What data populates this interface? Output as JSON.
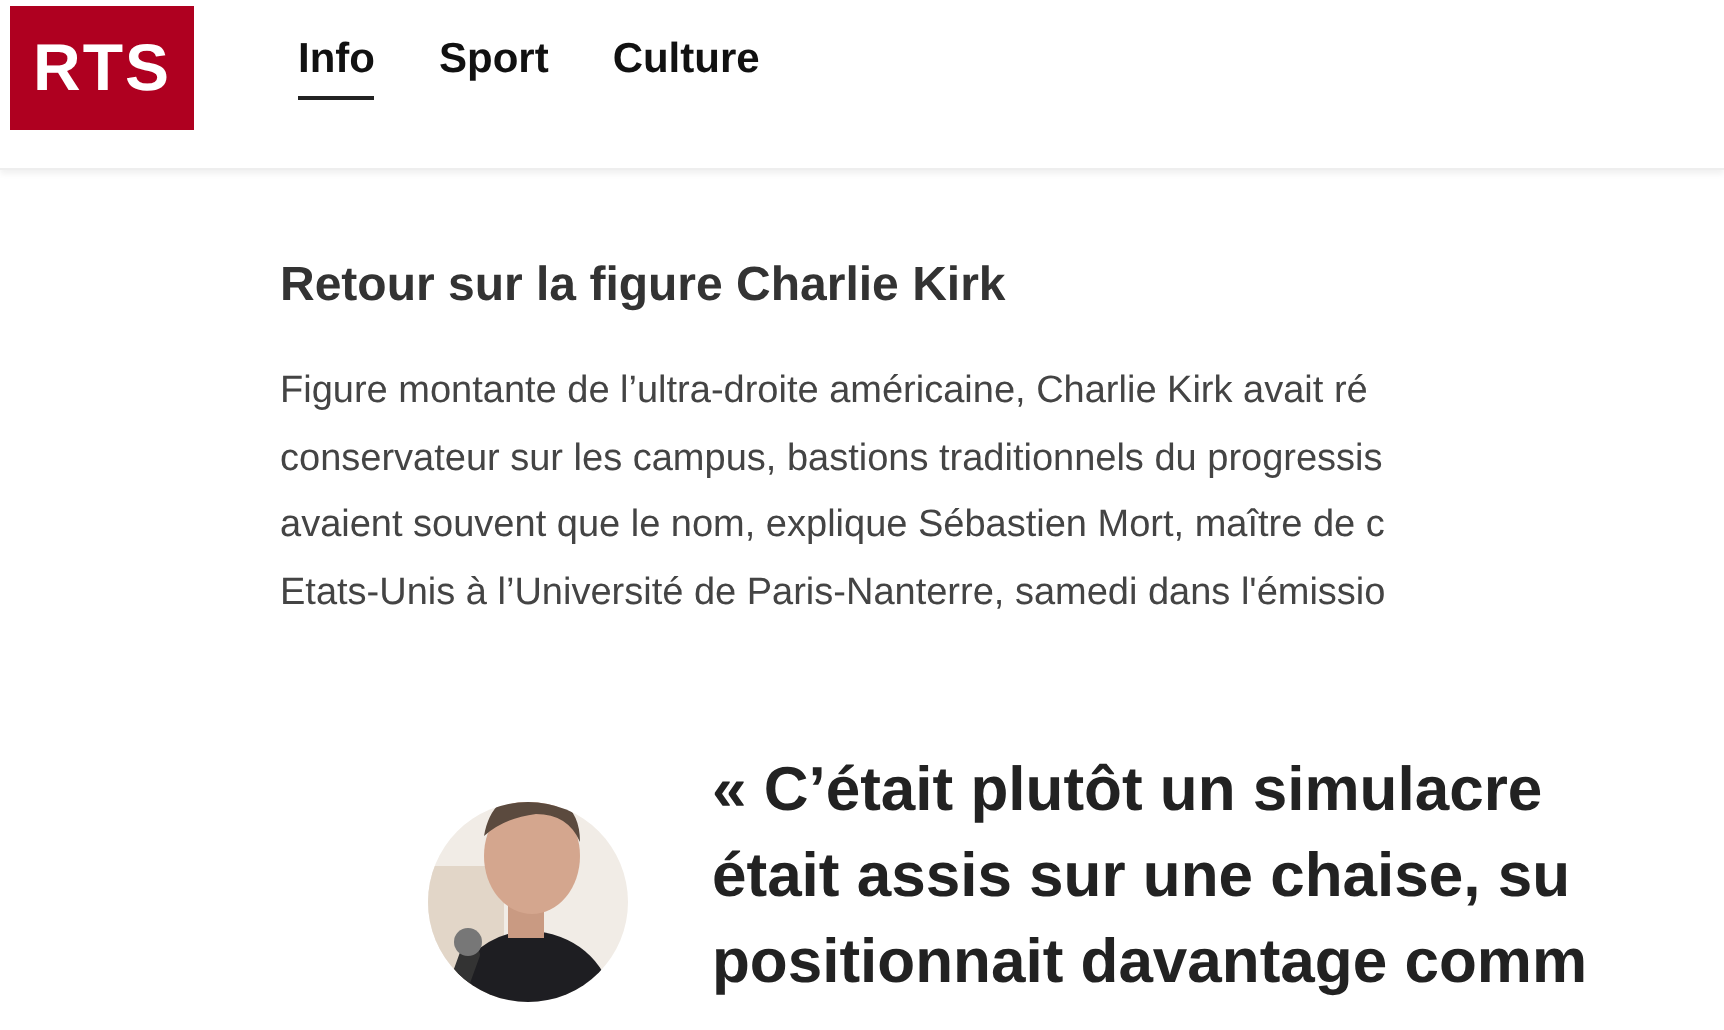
{
  "header": {
    "logo": "RTS",
    "nav": [
      {
        "label": "Info",
        "selected": true
      },
      {
        "label": "Sport",
        "selected": false
      },
      {
        "label": "Culture",
        "selected": false
      }
    ]
  },
  "article": {
    "heading": "Retour sur la figure Charlie Kirk",
    "paragraph_lines": [
      "Figure montante de l’ultra-droite américaine, Charlie Kirk avait ré",
      "conservateur sur les campus, bastions traditionnels du progressis",
      "avaient souvent que le nom, explique Sébastien Mort, maître de c",
      "Etats-Unis à l’Université de Paris-Nanterre, samedi dans l'émissio"
    ],
    "quote": {
      "avatar": {
        "kind": "picture"
      },
      "lines": [
        "« C’était plutôt un simulacre",
        "était assis sur une chaise, su",
        "positionnait davantage comm"
      ]
    }
  }
}
